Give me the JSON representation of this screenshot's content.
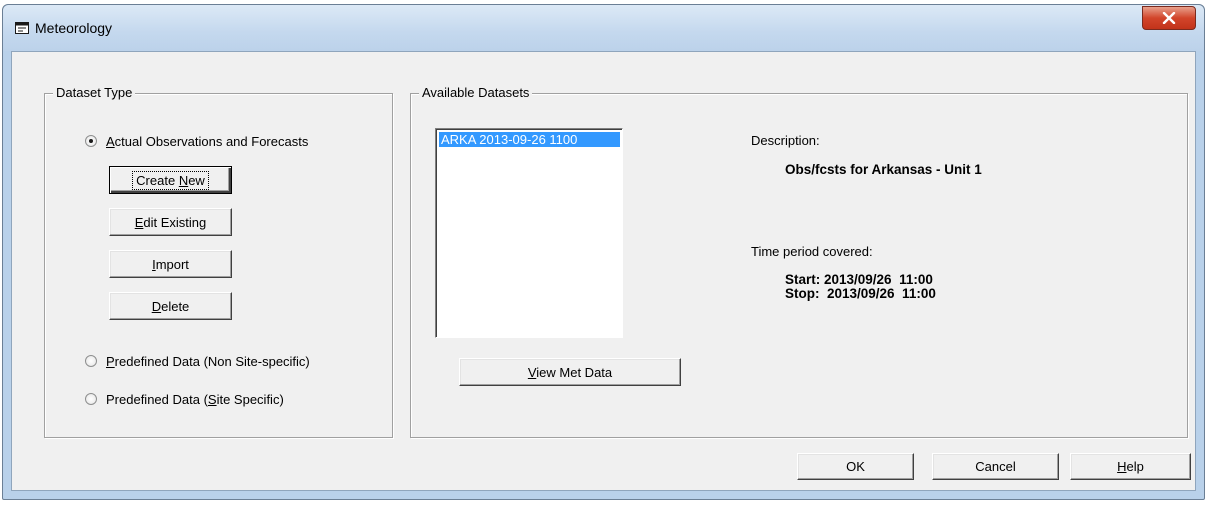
{
  "window": {
    "title": "Meteorology"
  },
  "dataset_type": {
    "legend": "Dataset Type",
    "radio_actual": {
      "before": "",
      "accel": "A",
      "after": "ctual Observations and Forecasts",
      "selected": true
    },
    "radio_predef_non": {
      "before": "",
      "accel": "P",
      "after": "redefined Data (Non Site-specific)",
      "selected": false
    },
    "radio_predef_site": {
      "before": "Predefined Data (",
      "accel": "S",
      "after": "ite Specific)",
      "selected": false
    },
    "create_new": {
      "before": "Create ",
      "accel": "N",
      "after": "ew"
    },
    "edit_existing": {
      "before": "",
      "accel": "E",
      "after": "dit Existing"
    },
    "import": {
      "before": "",
      "accel": "I",
      "after": "mport"
    },
    "delete": {
      "before": "",
      "accel": "D",
      "after": "elete"
    }
  },
  "available": {
    "legend": "Available Datasets",
    "items": [
      "ARKA 2013-09-26 1100"
    ],
    "view_met": {
      "before": "",
      "accel": "V",
      "after": "iew Met Data"
    },
    "description_label": "Description:",
    "description_value": "Obs/fcsts for Arkansas - Unit 1",
    "period_label": "Time period covered:",
    "start": "Start: 2013/09/26  11:00",
    "stop": "Stop:  2013/09/26  11:00"
  },
  "footer": {
    "ok": "OK",
    "cancel": "Cancel",
    "help": {
      "before": "",
      "accel": "H",
      "after": "elp"
    }
  }
}
